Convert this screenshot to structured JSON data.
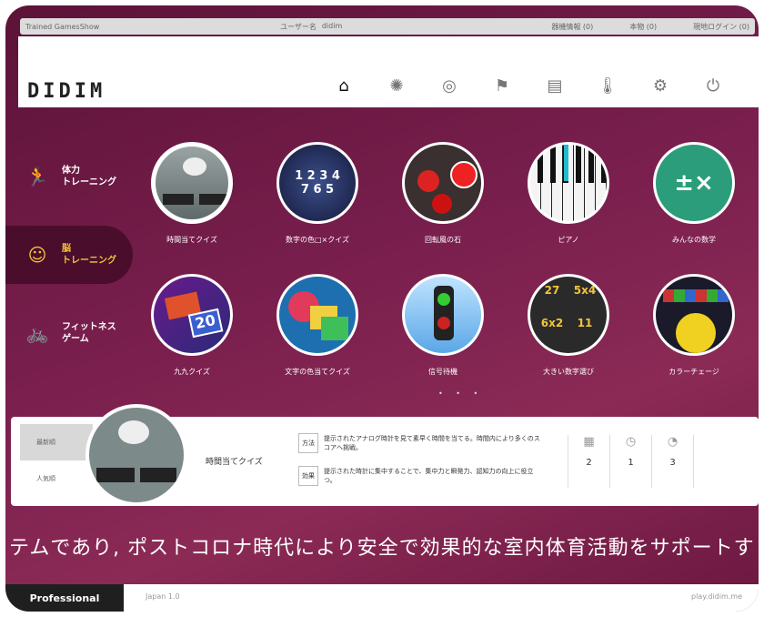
{
  "topbar": {
    "left": "Trained GamesShow",
    "mid_label": "ユーザー名",
    "mid_value": "didim",
    "right": [
      "器機情報 (0)",
      "本物 (0)",
      "現地ログイン (0)"
    ]
  },
  "header": {
    "logo": "DIDIM",
    "nav": [
      {
        "icon": "home-icon",
        "glyph": "⌂"
      },
      {
        "icon": "sun-icon",
        "glyph": "✺"
      },
      {
        "icon": "target-icon",
        "glyph": "◎"
      },
      {
        "icon": "podium-icon",
        "glyph": "⚑"
      },
      {
        "icon": "clipboard-icon",
        "glyph": "▤"
      },
      {
        "icon": "thermometer-icon",
        "glyph": "🌡"
      },
      {
        "icon": "gear-icon",
        "glyph": "⚙"
      },
      {
        "icon": "power-icon",
        "glyph": "⏻"
      }
    ]
  },
  "sidebar": [
    {
      "label": "体力\nトレーニング",
      "icon": "runner-icon",
      "glyph": "🏃"
    },
    {
      "label": "脳\nトレーニング",
      "icon": "brain-icon",
      "glyph": "☺"
    },
    {
      "label": "フィットネス\nゲーム",
      "icon": "bike-icon",
      "glyph": "🚲"
    }
  ],
  "games": [
    {
      "name": "時間当てクイズ"
    },
    {
      "name": "数字の色□×クイズ"
    },
    {
      "name": "回転風の石"
    },
    {
      "name": "ピアノ"
    },
    {
      "name": "みんなの数学"
    },
    {
      "name": "九九クイズ"
    },
    {
      "name": "文字の色当てクイズ"
    },
    {
      "name": "信号待機"
    },
    {
      "name": "大きい数字選び"
    },
    {
      "name": "カラーチェージ"
    }
  ],
  "pager": "• • •",
  "info": {
    "tabs": [
      "最新順",
      "人気順"
    ],
    "game_name": "時間当てクイズ",
    "method_tag": "方法",
    "method": "提示されたアナログ時計を見て素早く時間を当てる。時間内により多くのスコアへ挑戦。",
    "effect_tag": "効果",
    "effect": "提示された時計に集中することで、集中力と瞬発力、認知力の向上に役立つ。",
    "stats": [
      {
        "icon": "calendar-icon",
        "glyph": "▦",
        "value": "2"
      },
      {
        "icon": "timer-icon",
        "glyph": "◷",
        "value": "1"
      },
      {
        "icon": "clock-icon",
        "glyph": "◔",
        "value": "3"
      }
    ]
  },
  "banner": "テムであり, ポストコロナ時代により安全で効果的な室内体育活動をサポートす",
  "footer": {
    "edition": "Professional",
    "version": "Japan 1.0",
    "url": "play.didim.me"
  }
}
